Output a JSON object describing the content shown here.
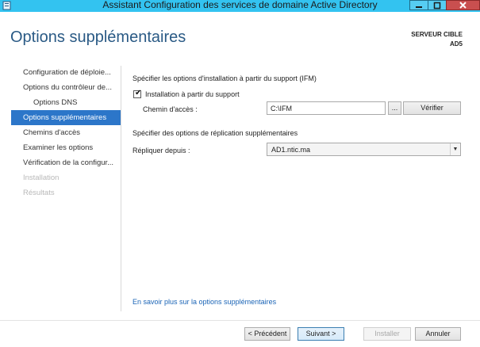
{
  "window": {
    "title": "Assistant Configuration des services de domaine Active Directory",
    "caption_min": "▁",
    "caption_max": "□",
    "caption_close": "✕"
  },
  "header": {
    "page_title": "Options supplémentaires",
    "target_label": "SERVEUR CIBLE",
    "target_value": "AD5"
  },
  "nav": {
    "items": [
      {
        "label": "Configuration de déploie...",
        "state": "normal"
      },
      {
        "label": "Options du contrôleur de...",
        "state": "normal"
      },
      {
        "label": "Options DNS",
        "state": "normal",
        "sub": true
      },
      {
        "label": "Options supplémentaires",
        "state": "active"
      },
      {
        "label": "Chemins d'accès",
        "state": "normal"
      },
      {
        "label": "Examiner les options",
        "state": "normal"
      },
      {
        "label": "Vérification de la configur...",
        "state": "normal"
      },
      {
        "label": "Installation",
        "state": "disabled"
      },
      {
        "label": "Résultats",
        "state": "disabled"
      }
    ]
  },
  "ifm": {
    "section_title": "Spécifier les options d'installation à partir du support (IFM)",
    "checkbox_label": "Installation à partir du support",
    "checked": true,
    "path_label": "Chemin d'accès :",
    "path_value": "C:\\IFM",
    "browse_label": "...",
    "verify_label": "Vérifier"
  },
  "replication": {
    "section_title": "Spécifier des options de réplication supplémentaires",
    "replicate_label": "Répliquer depuis :",
    "replicate_value": "AD1.ntic.ma"
  },
  "links": {
    "learn_more": "En savoir plus sur la options supplémentaires"
  },
  "footer": {
    "back_label": "< Précédent",
    "next_label": "Suivant >",
    "install_label": "Installer",
    "cancel_label": "Annuler"
  },
  "colors": {
    "titlebar": "#33c3f0",
    "accent": "#2c76c9",
    "title_text": "#2a5a85",
    "link": "#1a64b6"
  },
  "icons": [
    "server-manager-icon",
    "minimize-icon",
    "maximize-icon",
    "close-icon",
    "checkmark-icon",
    "chevron-down-icon"
  ]
}
